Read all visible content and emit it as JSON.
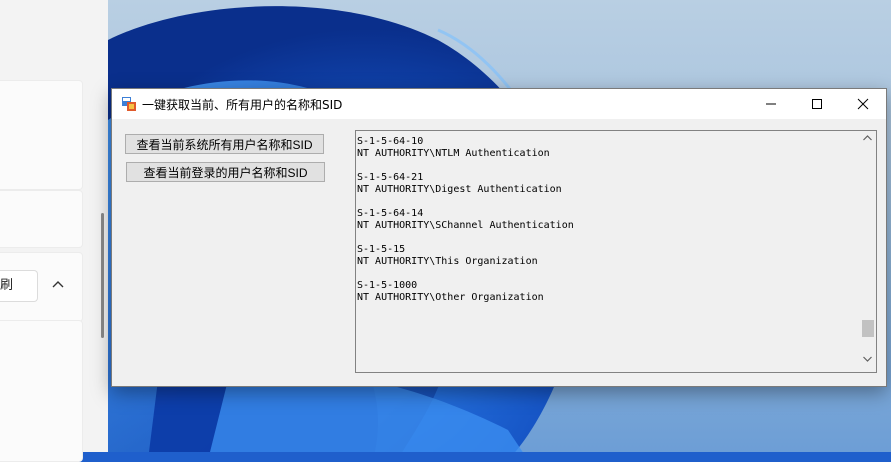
{
  "background_app": {
    "dropdown_text": "刷"
  },
  "window": {
    "title": "一键获取当前、所有用户的名称和SID"
  },
  "buttons": {
    "list_all": "查看当前系统所有用户名称和SID",
    "list_current": "查看当前登录的用户名称和SID"
  },
  "output": [
    {
      "sid": "S-1-5-64-10",
      "name": "NT AUTHORITY\\NTLM Authentication"
    },
    {
      "sid": "S-1-5-64-21",
      "name": "NT AUTHORITY\\Digest Authentication"
    },
    {
      "sid": "S-1-5-64-14",
      "name": "NT AUTHORITY\\SChannel Authentication"
    },
    {
      "sid": "S-1-5-15",
      "name": "NT AUTHORITY\\This Organization"
    },
    {
      "sid": "S-1-5-1000",
      "name": "NT AUTHORITY\\Other Organization"
    }
  ],
  "colors": {
    "wallpaper_blue": "#1f5fcc",
    "window_bg": "#f0f0f0",
    "button_bg": "#e1e1e1"
  },
  "icons": [
    "app-icon",
    "minimize-icon",
    "maximize-icon",
    "close-icon",
    "chevron-up-icon",
    "scroll-up-icon",
    "scroll-down-icon"
  ]
}
